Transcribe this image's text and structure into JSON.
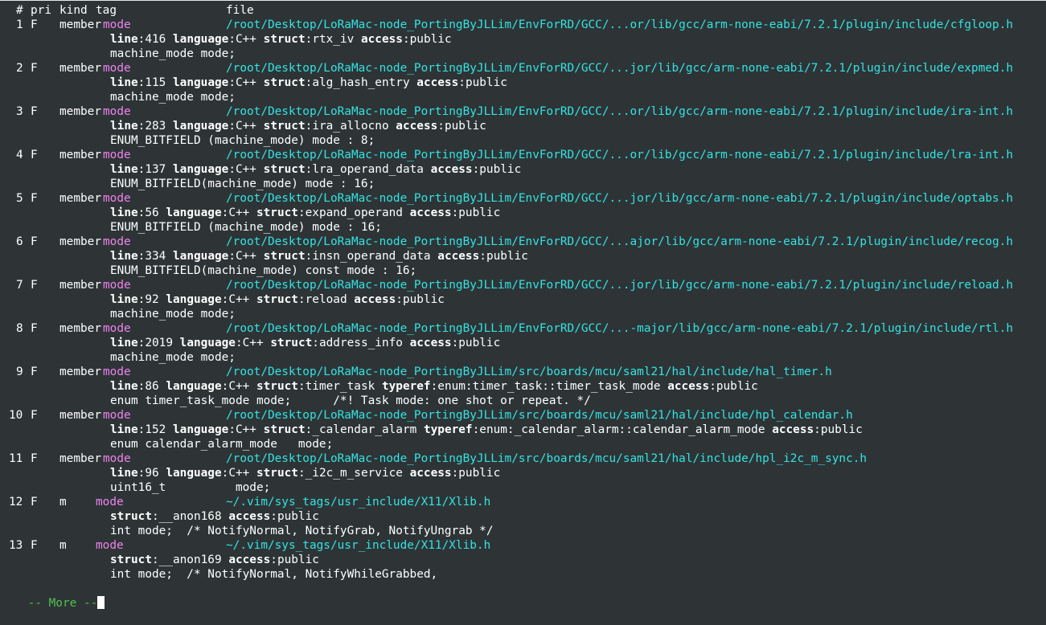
{
  "header": {
    "num": "#",
    "pri": "pri",
    "kind": "kind",
    "tag": "tag",
    "file": "file"
  },
  "entries": [
    {
      "num": "1",
      "pri": "F",
      "kind": "member",
      "tag": "mode",
      "file": "/root/Desktop/LoRaMac-node_PortingByJLLim/EnvForRD/GCC/...or/lib/gcc/arm-none-eabi/7.2.1/plugin/include/cfgloop.h",
      "info": [
        {
          "key": "line",
          "val": "416"
        },
        {
          "key": "language",
          "val": "C++"
        },
        {
          "key": "struct",
          "val": "rtx_iv"
        },
        {
          "key": "access",
          "val": "public"
        }
      ],
      "code": "machine_mode mode;"
    },
    {
      "num": "2",
      "pri": "F",
      "kind": "member",
      "tag": "mode",
      "file": "/root/Desktop/LoRaMac-node_PortingByJLLim/EnvForRD/GCC/...jor/lib/gcc/arm-none-eabi/7.2.1/plugin/include/expmed.h",
      "info": [
        {
          "key": "line",
          "val": "115"
        },
        {
          "key": "language",
          "val": "C++"
        },
        {
          "key": "struct",
          "val": "alg_hash_entry"
        },
        {
          "key": "access",
          "val": "public"
        }
      ],
      "code": "machine_mode mode;"
    },
    {
      "num": "3",
      "pri": "F",
      "kind": "member",
      "tag": "mode",
      "file": "/root/Desktop/LoRaMac-node_PortingByJLLim/EnvForRD/GCC/...or/lib/gcc/arm-none-eabi/7.2.1/plugin/include/ira-int.h",
      "info": [
        {
          "key": "line",
          "val": "283"
        },
        {
          "key": "language",
          "val": "C++"
        },
        {
          "key": "struct",
          "val": "ira_allocno"
        },
        {
          "key": "access",
          "val": "public"
        }
      ],
      "code": "ENUM_BITFIELD (machine_mode) mode : 8;"
    },
    {
      "num": "4",
      "pri": "F",
      "kind": "member",
      "tag": "mode",
      "file": "/root/Desktop/LoRaMac-node_PortingByJLLim/EnvForRD/GCC/...or/lib/gcc/arm-none-eabi/7.2.1/plugin/include/lra-int.h",
      "info": [
        {
          "key": "line",
          "val": "137"
        },
        {
          "key": "language",
          "val": "C++"
        },
        {
          "key": "struct",
          "val": "lra_operand_data"
        },
        {
          "key": "access",
          "val": "public"
        }
      ],
      "code": "ENUM_BITFIELD(machine_mode) mode : 16;"
    },
    {
      "num": "5",
      "pri": "F",
      "kind": "member",
      "tag": "mode",
      "file": "/root/Desktop/LoRaMac-node_PortingByJLLim/EnvForRD/GCC/...jor/lib/gcc/arm-none-eabi/7.2.1/plugin/include/optabs.h",
      "info": [
        {
          "key": "line",
          "val": "56"
        },
        {
          "key": "language",
          "val": "C++"
        },
        {
          "key": "struct",
          "val": "expand_operand"
        },
        {
          "key": "access",
          "val": "public"
        }
      ],
      "code": "ENUM_BITFIELD (machine_mode) mode : 16;"
    },
    {
      "num": "6",
      "pri": "F",
      "kind": "member",
      "tag": "mode",
      "file": "/root/Desktop/LoRaMac-node_PortingByJLLim/EnvForRD/GCC/...ajor/lib/gcc/arm-none-eabi/7.2.1/plugin/include/recog.h",
      "info": [
        {
          "key": "line",
          "val": "334"
        },
        {
          "key": "language",
          "val": "C++"
        },
        {
          "key": "struct",
          "val": "insn_operand_data"
        },
        {
          "key": "access",
          "val": "public"
        }
      ],
      "code": "ENUM_BITFIELD(machine_mode) const mode : 16;"
    },
    {
      "num": "7",
      "pri": "F",
      "kind": "member",
      "tag": "mode",
      "file": "/root/Desktop/LoRaMac-node_PortingByJLLim/EnvForRD/GCC/...jor/lib/gcc/arm-none-eabi/7.2.1/plugin/include/reload.h",
      "info": [
        {
          "key": "line",
          "val": "92"
        },
        {
          "key": "language",
          "val": "C++"
        },
        {
          "key": "struct",
          "val": "reload"
        },
        {
          "key": "access",
          "val": "public"
        }
      ],
      "code": "machine_mode mode;"
    },
    {
      "num": "8",
      "pri": "F",
      "kind": "member",
      "tag": "mode",
      "file": "/root/Desktop/LoRaMac-node_PortingByJLLim/EnvForRD/GCC/...-major/lib/gcc/arm-none-eabi/7.2.1/plugin/include/rtl.h",
      "info": [
        {
          "key": "line",
          "val": "2019"
        },
        {
          "key": "language",
          "val": "C++"
        },
        {
          "key": "struct",
          "val": "address_info"
        },
        {
          "key": "access",
          "val": "public"
        }
      ],
      "code": "machine_mode mode;"
    },
    {
      "num": "9",
      "pri": "F",
      "kind": "member",
      "tag": "mode",
      "file": "/root/Desktop/LoRaMac-node_PortingByJLLim/src/boards/mcu/saml21/hal/include/hal_timer.h",
      "info": [
        {
          "key": "line",
          "val": "86"
        },
        {
          "key": "language",
          "val": "C++"
        },
        {
          "key": "struct",
          "val": "timer_task"
        },
        {
          "key": "typeref",
          "val": "enum:timer_task::timer_task_mode"
        },
        {
          "key": "access",
          "val": "public"
        }
      ],
      "code": "enum timer_task_mode mode;      /*! Task mode: one shot or repeat. */"
    },
    {
      "num": "10",
      "pri": "F",
      "kind": "member",
      "tag": "mode",
      "file": "/root/Desktop/LoRaMac-node_PortingByJLLim/src/boards/mcu/saml21/hal/include/hpl_calendar.h",
      "info": [
        {
          "key": "line",
          "val": "152"
        },
        {
          "key": "language",
          "val": "C++"
        },
        {
          "key": "struct",
          "val": "_calendar_alarm"
        },
        {
          "key": "typeref",
          "val": "enum:_calendar_alarm::calendar_alarm_mode"
        },
        {
          "key": "access",
          "val": "public"
        }
      ],
      "code": "enum calendar_alarm_mode   mode;"
    },
    {
      "num": "11",
      "pri": "F",
      "kind": "member",
      "tag": "mode",
      "file": "/root/Desktop/LoRaMac-node_PortingByJLLim/src/boards/mcu/saml21/hal/include/hpl_i2c_m_sync.h",
      "info": [
        {
          "key": "line",
          "val": "96"
        },
        {
          "key": "language",
          "val": "C++"
        },
        {
          "key": "struct",
          "val": "_i2c_m_service"
        },
        {
          "key": "access",
          "val": "public"
        }
      ],
      "code": "uint16_t          mode;"
    },
    {
      "num": "12",
      "pri": "F",
      "kind": "m",
      "tag": "mode",
      "file": "~/.vim/sys_tags/usr_include/X11/Xlib.h",
      "info": [
        {
          "key": "struct",
          "val": "__anon168"
        },
        {
          "key": "access",
          "val": "public"
        }
      ],
      "code": "int mode;  /* NotifyNormal, NotifyGrab, NotifyUngrab */"
    },
    {
      "num": "13",
      "pri": "F",
      "kind": "m",
      "tag": "mode",
      "file": "~/.vim/sys_tags/usr_include/X11/Xlib.h",
      "info": [
        {
          "key": "struct",
          "val": "__anon169"
        },
        {
          "key": "access",
          "val": "public"
        }
      ],
      "code": "int mode;  /* NotifyNormal, NotifyWhileGrabbed,"
    }
  ],
  "more_prompt": "-- More --",
  "colors": {
    "background": "#2e3436",
    "text": "#ffffff",
    "file_path": "#34e2e2",
    "tag": "#ee82ee",
    "more_prompt": "#4ec24e"
  }
}
